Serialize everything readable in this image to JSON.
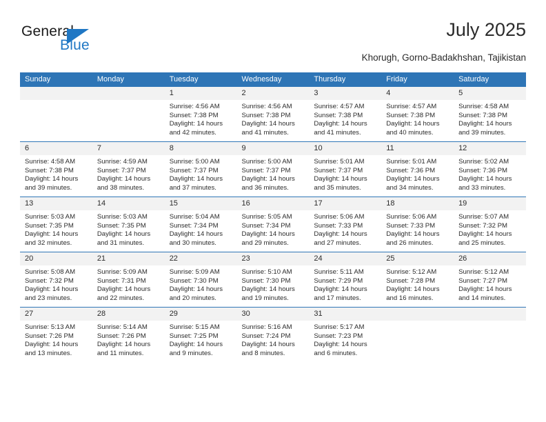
{
  "logo": {
    "word_top": "General",
    "word_bottom": "Blue",
    "accent_color": "#1f77c4",
    "triangle_icon": "triangle-icon"
  },
  "header": {
    "title": "July 2025",
    "subtitle": "Khorugh, Gorno-Badakhshan, Tajikistan"
  },
  "theme": {
    "header_blue": "#2e75b6",
    "daynum_gray": "#f2f2f2",
    "text": "#2b2b2b"
  },
  "calendar": {
    "weekday_headers": [
      "Sunday",
      "Monday",
      "Tuesday",
      "Wednesday",
      "Thursday",
      "Friday",
      "Saturday"
    ],
    "labels": {
      "sunrise": "Sunrise:",
      "sunset": "Sunset:",
      "daylight": "Daylight:"
    },
    "weeks": [
      [
        {
          "day": "",
          "empty": true
        },
        {
          "day": "",
          "empty": true
        },
        {
          "day": "1",
          "sunrise": "Sunrise: 4:56 AM",
          "sunset": "Sunset: 7:38 PM",
          "daylight": "Daylight: 14 hours and 42 minutes."
        },
        {
          "day": "2",
          "sunrise": "Sunrise: 4:56 AM",
          "sunset": "Sunset: 7:38 PM",
          "daylight": "Daylight: 14 hours and 41 minutes."
        },
        {
          "day": "3",
          "sunrise": "Sunrise: 4:57 AM",
          "sunset": "Sunset: 7:38 PM",
          "daylight": "Daylight: 14 hours and 41 minutes."
        },
        {
          "day": "4",
          "sunrise": "Sunrise: 4:57 AM",
          "sunset": "Sunset: 7:38 PM",
          "daylight": "Daylight: 14 hours and 40 minutes."
        },
        {
          "day": "5",
          "sunrise": "Sunrise: 4:58 AM",
          "sunset": "Sunset: 7:38 PM",
          "daylight": "Daylight: 14 hours and 39 minutes."
        }
      ],
      [
        {
          "day": "6",
          "sunrise": "Sunrise: 4:58 AM",
          "sunset": "Sunset: 7:38 PM",
          "daylight": "Daylight: 14 hours and 39 minutes."
        },
        {
          "day": "7",
          "sunrise": "Sunrise: 4:59 AM",
          "sunset": "Sunset: 7:37 PM",
          "daylight": "Daylight: 14 hours and 38 minutes."
        },
        {
          "day": "8",
          "sunrise": "Sunrise: 5:00 AM",
          "sunset": "Sunset: 7:37 PM",
          "daylight": "Daylight: 14 hours and 37 minutes."
        },
        {
          "day": "9",
          "sunrise": "Sunrise: 5:00 AM",
          "sunset": "Sunset: 7:37 PM",
          "daylight": "Daylight: 14 hours and 36 minutes."
        },
        {
          "day": "10",
          "sunrise": "Sunrise: 5:01 AM",
          "sunset": "Sunset: 7:37 PM",
          "daylight": "Daylight: 14 hours and 35 minutes."
        },
        {
          "day": "11",
          "sunrise": "Sunrise: 5:01 AM",
          "sunset": "Sunset: 7:36 PM",
          "daylight": "Daylight: 14 hours and 34 minutes."
        },
        {
          "day": "12",
          "sunrise": "Sunrise: 5:02 AM",
          "sunset": "Sunset: 7:36 PM",
          "daylight": "Daylight: 14 hours and 33 minutes."
        }
      ],
      [
        {
          "day": "13",
          "sunrise": "Sunrise: 5:03 AM",
          "sunset": "Sunset: 7:35 PM",
          "daylight": "Daylight: 14 hours and 32 minutes."
        },
        {
          "day": "14",
          "sunrise": "Sunrise: 5:03 AM",
          "sunset": "Sunset: 7:35 PM",
          "daylight": "Daylight: 14 hours and 31 minutes."
        },
        {
          "day": "15",
          "sunrise": "Sunrise: 5:04 AM",
          "sunset": "Sunset: 7:34 PM",
          "daylight": "Daylight: 14 hours and 30 minutes."
        },
        {
          "day": "16",
          "sunrise": "Sunrise: 5:05 AM",
          "sunset": "Sunset: 7:34 PM",
          "daylight": "Daylight: 14 hours and 29 minutes."
        },
        {
          "day": "17",
          "sunrise": "Sunrise: 5:06 AM",
          "sunset": "Sunset: 7:33 PM",
          "daylight": "Daylight: 14 hours and 27 minutes."
        },
        {
          "day": "18",
          "sunrise": "Sunrise: 5:06 AM",
          "sunset": "Sunset: 7:33 PM",
          "daylight": "Daylight: 14 hours and 26 minutes."
        },
        {
          "day": "19",
          "sunrise": "Sunrise: 5:07 AM",
          "sunset": "Sunset: 7:32 PM",
          "daylight": "Daylight: 14 hours and 25 minutes."
        }
      ],
      [
        {
          "day": "20",
          "sunrise": "Sunrise: 5:08 AM",
          "sunset": "Sunset: 7:32 PM",
          "daylight": "Daylight: 14 hours and 23 minutes."
        },
        {
          "day": "21",
          "sunrise": "Sunrise: 5:09 AM",
          "sunset": "Sunset: 7:31 PM",
          "daylight": "Daylight: 14 hours and 22 minutes."
        },
        {
          "day": "22",
          "sunrise": "Sunrise: 5:09 AM",
          "sunset": "Sunset: 7:30 PM",
          "daylight": "Daylight: 14 hours and 20 minutes."
        },
        {
          "day": "23",
          "sunrise": "Sunrise: 5:10 AM",
          "sunset": "Sunset: 7:30 PM",
          "daylight": "Daylight: 14 hours and 19 minutes."
        },
        {
          "day": "24",
          "sunrise": "Sunrise: 5:11 AM",
          "sunset": "Sunset: 7:29 PM",
          "daylight": "Daylight: 14 hours and 17 minutes."
        },
        {
          "day": "25",
          "sunrise": "Sunrise: 5:12 AM",
          "sunset": "Sunset: 7:28 PM",
          "daylight": "Daylight: 14 hours and 16 minutes."
        },
        {
          "day": "26",
          "sunrise": "Sunrise: 5:12 AM",
          "sunset": "Sunset: 7:27 PM",
          "daylight": "Daylight: 14 hours and 14 minutes."
        }
      ],
      [
        {
          "day": "27",
          "sunrise": "Sunrise: 5:13 AM",
          "sunset": "Sunset: 7:26 PM",
          "daylight": "Daylight: 14 hours and 13 minutes."
        },
        {
          "day": "28",
          "sunrise": "Sunrise: 5:14 AM",
          "sunset": "Sunset: 7:26 PM",
          "daylight": "Daylight: 14 hours and 11 minutes."
        },
        {
          "day": "29",
          "sunrise": "Sunrise: 5:15 AM",
          "sunset": "Sunset: 7:25 PM",
          "daylight": "Daylight: 14 hours and 9 minutes."
        },
        {
          "day": "30",
          "sunrise": "Sunrise: 5:16 AM",
          "sunset": "Sunset: 7:24 PM",
          "daylight": "Daylight: 14 hours and 8 minutes."
        },
        {
          "day": "31",
          "sunrise": "Sunrise: 5:17 AM",
          "sunset": "Sunset: 7:23 PM",
          "daylight": "Daylight: 14 hours and 6 minutes."
        },
        {
          "day": "",
          "empty": true
        },
        {
          "day": "",
          "empty": true
        }
      ]
    ]
  }
}
